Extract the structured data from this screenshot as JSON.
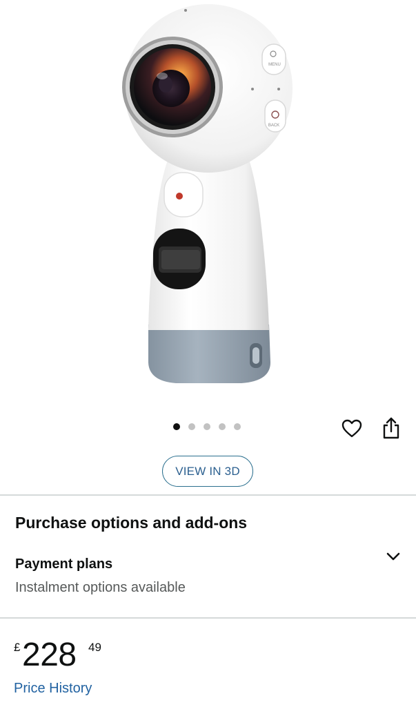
{
  "product": {
    "camera_button_labels": {
      "menu": "MENU",
      "back": "BACK"
    }
  },
  "carousel": {
    "dot_count": 5,
    "active_index": 0
  },
  "actions": {
    "view_3d_label": "VIEW IN 3D"
  },
  "purchase": {
    "section_title": "Purchase options and add-ons",
    "payment_plans_title": "Payment plans",
    "payment_plans_subtitle": "Instalment options available"
  },
  "price": {
    "currency_symbol": "£",
    "whole": "228",
    "fraction": "49",
    "history_link": "Price History"
  },
  "icons": {
    "wishlist": "heart-icon",
    "share": "share-icon",
    "expand": "chevron-down-icon"
  },
  "colors": {
    "link": "#2162a1",
    "divider": "#d5d9d9",
    "view3d_border": "#2a6f8e"
  }
}
